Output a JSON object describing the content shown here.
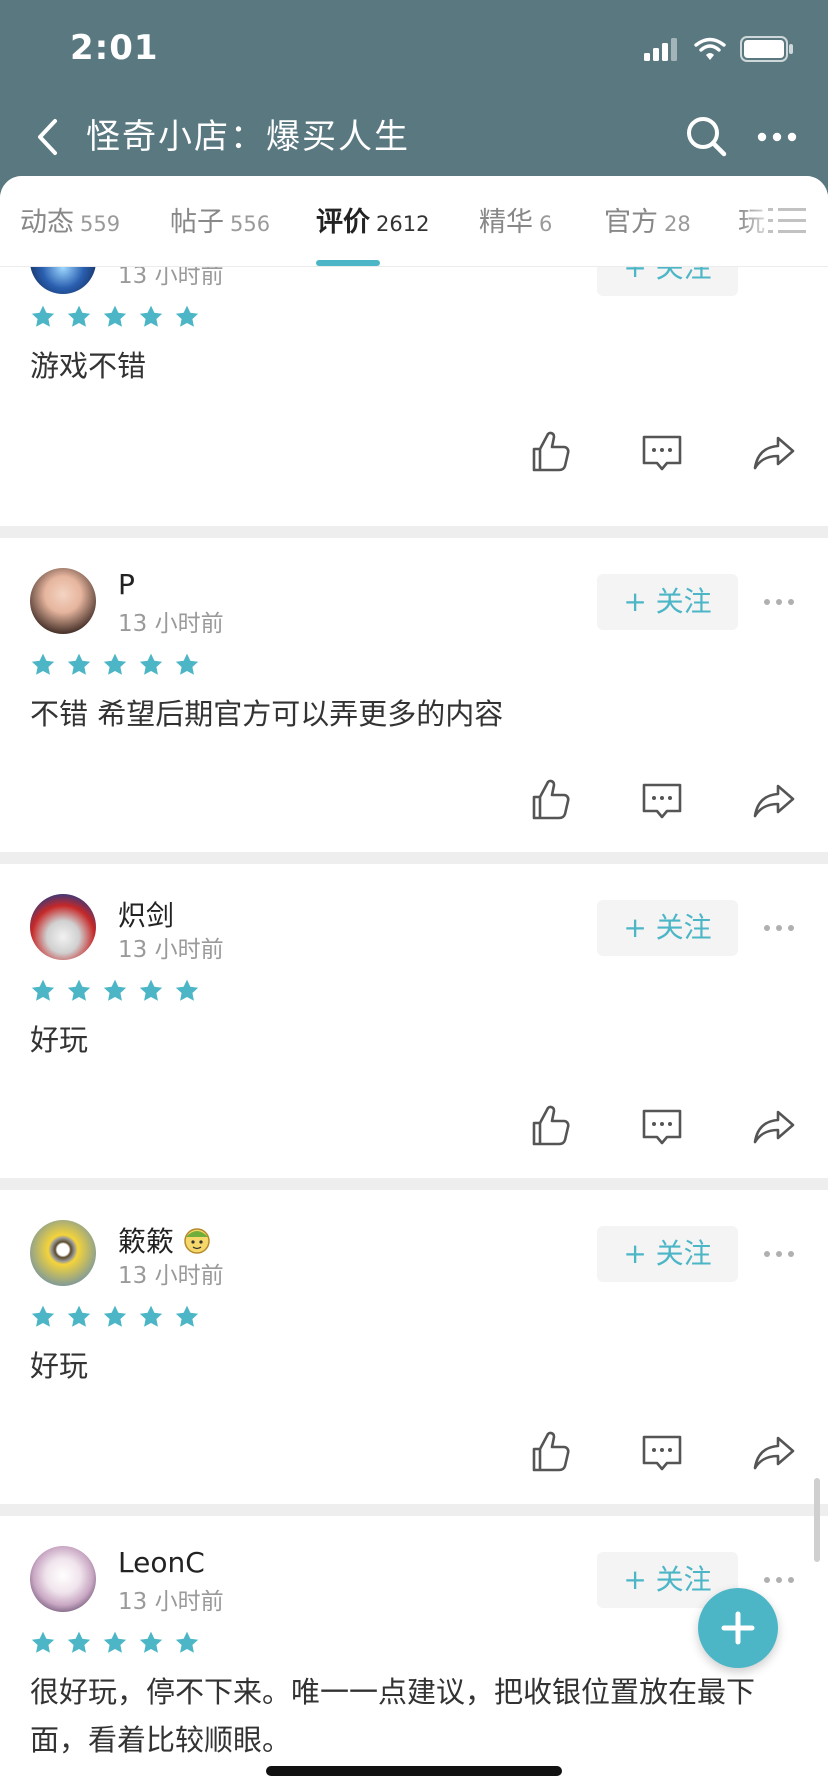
{
  "status_bar": {
    "time": "2:01",
    "signal_icon": "cellular-signal-icon",
    "wifi_icon": "wifi-icon",
    "battery_icon": "battery-icon"
  },
  "header": {
    "title": "怪奇小店：爆买人生",
    "back_icon": "back-arrow-icon",
    "search_icon": "search-icon",
    "more_icon": "more-icon"
  },
  "tabs": [
    {
      "label": "动态",
      "count": "559"
    },
    {
      "label": "帖子",
      "count": "556"
    },
    {
      "label": "评价",
      "count": "2612",
      "active": true
    },
    {
      "label": "精华",
      "count": "6"
    },
    {
      "label": "官方",
      "count": "28"
    },
    {
      "label": "玩"
    }
  ],
  "follow_label": "+ 关注",
  "reviews": [
    {
      "username": "",
      "time": "13 小时前",
      "rating": 5,
      "text": "游戏不错"
    },
    {
      "username": "P",
      "time": "13 小时前",
      "rating": 5,
      "text": "不错 希望后期官方可以弄更多的内容"
    },
    {
      "username": "炽剑",
      "time": "13 小时前",
      "rating": 5,
      "text": "好玩"
    },
    {
      "username": "簌簌",
      "time": "13 小时前",
      "rating": 5,
      "text": "好玩",
      "badge_icon": "emoji-badge-icon"
    },
    {
      "username": "LeonC",
      "time": "13 小时前",
      "rating": 5,
      "text": "很好玩，停不下来。唯一一点建议，把收银位置放在最下面，看着比较顺眼。"
    }
  ],
  "colors": {
    "header_bg": "#5a7880",
    "accent": "#4cb6c7",
    "star": "#4cb6c7"
  },
  "fab_icon": "plus-icon"
}
